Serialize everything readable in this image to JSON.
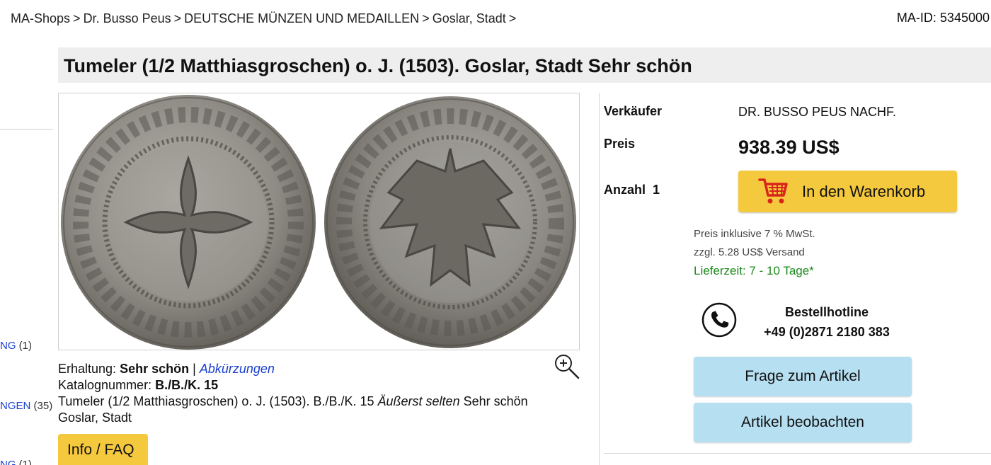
{
  "breadcrumb": {
    "items": [
      "MA-Shops",
      "Dr. Busso Peus",
      "DEUTSCHE MÜNZEN UND MEDAILLEN",
      "Goslar, Stadt"
    ],
    "separator": ">"
  },
  "ma_id": "MA-ID: 5345000",
  "sidebar": {
    "items": [
      {
        "label": "NG",
        "count": "(1)"
      },
      {
        "label": "NGEN",
        "count": "(35)"
      },
      {
        "label": "NG",
        "count": "(1)"
      }
    ]
  },
  "product": {
    "title": "Tumeler (1/2 Matthiasgroschen) o. J. (1503). Goslar, Stadt Sehr schön",
    "erhaltung_label": "Erhaltung:",
    "erhaltung_value": "Sehr schön",
    "divider": "|",
    "abkuerzungen": "Abkürzungen",
    "katalog_label": "Katalognummer:",
    "katalog_value": "B./B./K. 15",
    "description_start": "Tumeler (1/2 Matthiasgroschen) o. J. (1503). B./B./K. 15 ",
    "description_em": "Äußerst selten",
    "description_end": " Sehr schön",
    "description_line2": "Goslar, Stadt",
    "info_button": "Info / FAQ"
  },
  "purchase": {
    "seller_label": "Verkäufer",
    "seller_value": "DR. BUSSO PEUS NACHF.",
    "price_label": "Preis",
    "price_value": "938.39 US$",
    "quantity_label": "Anzahl",
    "quantity_value": "1",
    "cart_button": "In den Warenkorb",
    "tax_note": "Preis inklusive 7 % MwSt.",
    "shipping_note": "zzgl. 5.28 US$ Versand",
    "delivery_time": "Lieferzeit: 7 - 10 Tage*",
    "hotline_title": "Bestellhotline",
    "hotline_number": "+49 (0)2871 2180 383",
    "ask_button": "Frage zum Artikel",
    "watch_button": "Artikel beobachten"
  },
  "colors": {
    "button_yellow": "#f5c93e",
    "button_blue": "#b6dff2",
    "link_blue": "#1a3fd0",
    "delivery_green": "#1b8a1b",
    "cart_red": "#d8251c",
    "title_bar_bg": "#eeeeee"
  },
  "icons": {
    "zoom": "magnifier-plus-icon",
    "cart": "shopping-cart-icon",
    "phone": "phone-icon"
  }
}
